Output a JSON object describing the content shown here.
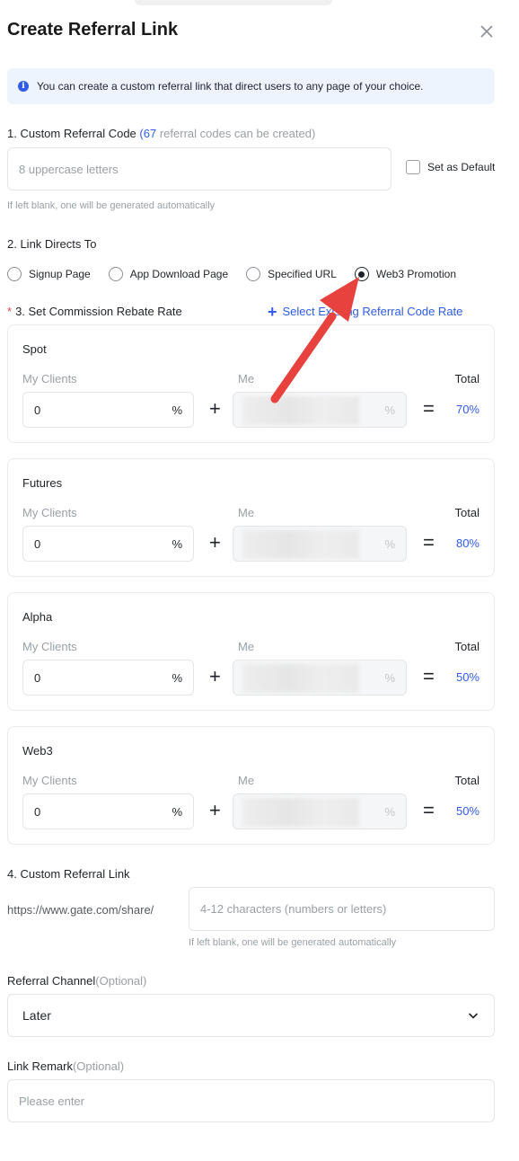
{
  "dialog": {
    "title": "Create Referral Link"
  },
  "info": {
    "text": "You can create a custom referral link that direct users to any page of your choice."
  },
  "section1": {
    "title": "1. Custom Referral Code",
    "count": "67",
    "count_suffix": "referral codes can be created)",
    "paren_open": "(",
    "placeholder": "8 uppercase letters",
    "default_label": "Set as Default",
    "hint": "If left blank, one will be generated automatically"
  },
  "section2": {
    "title": "2. Link Directs To",
    "options": [
      "Signup Page",
      "App Download Page",
      "Specified URL",
      "Web3 Promotion"
    ],
    "selected": "Web3 Promotion"
  },
  "section3": {
    "title": "3. Set Commission Rebate Rate",
    "select_link": "Select Existing Referral Code Rate",
    "labels": {
      "mine": "My Clients",
      "me": "Me",
      "total": "Total"
    },
    "cards": [
      {
        "name": "Spot",
        "mine": "0",
        "total": "70%"
      },
      {
        "name": "Futures",
        "mine": "0",
        "total": "80%"
      },
      {
        "name": "Alpha",
        "mine": "0",
        "total": "50%"
      },
      {
        "name": "Web3",
        "mine": "0",
        "total": "50%"
      }
    ],
    "percent": "%",
    "plus": "+",
    "equals": "="
  },
  "section4": {
    "title": "4. Custom Referral Link",
    "prefix": "https://www.gate.com/share/",
    "placeholder": "4-12 characters (numbers or letters)",
    "hint": "If left blank, one will be generated automatically"
  },
  "channel": {
    "label": "Referral Channel",
    "optional": "(Optional)",
    "value": "Later"
  },
  "remark": {
    "label": "Link Remark",
    "optional": "(Optional)",
    "placeholder": "Please enter"
  },
  "colors": {
    "accent": "#2f5ce8",
    "info_bg": "#eef4fd",
    "arrow": "#e8423f"
  }
}
